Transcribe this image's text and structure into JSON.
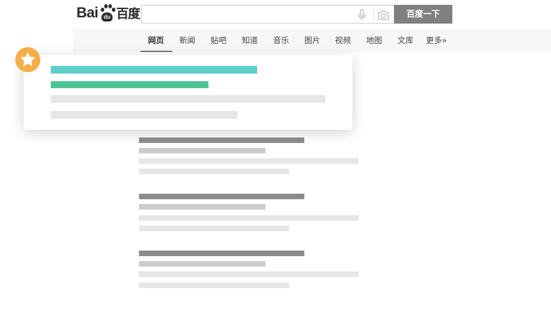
{
  "logo": {
    "bai": "Bai",
    "paw_du": "du",
    "cn": "百度"
  },
  "search": {
    "value": "",
    "placeholder": "",
    "button_label": "百度一下"
  },
  "nav": {
    "items": [
      {
        "label": "网页",
        "active": true
      },
      {
        "label": "新闻"
      },
      {
        "label": "贴吧"
      },
      {
        "label": "知道"
      },
      {
        "label": "音乐"
      },
      {
        "label": "图片"
      },
      {
        "label": "视频"
      },
      {
        "label": "地图"
      },
      {
        "label": "文库"
      },
      {
        "label": "更多»"
      }
    ]
  },
  "colors": {
    "accent_teal": "#5ccfc9",
    "accent_green": "#4cc393",
    "badge_orange": "#f7ad48",
    "placeholder_light": "#e6e6e6",
    "placeholder_dark": "#8c8c8c",
    "placeholder_mid": "#cccccc",
    "search_button": "#808080"
  },
  "icons": {
    "mic": "microphone-icon",
    "camera": "camera-icon",
    "badge": "star-icon"
  },
  "results_count": 3
}
